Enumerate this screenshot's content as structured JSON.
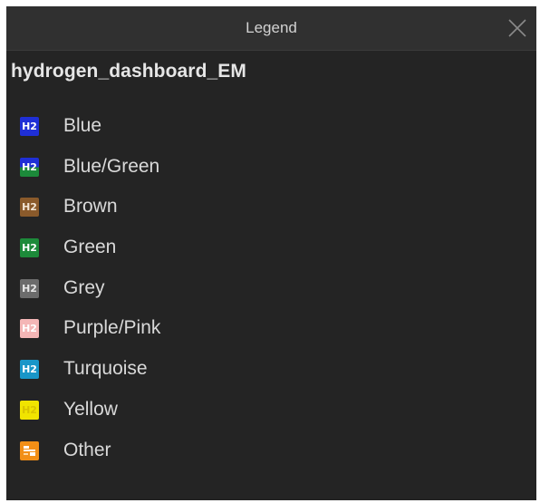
{
  "window": {
    "title": "Legend"
  },
  "layer": {
    "title": "hydrogen_dashboard_EM"
  },
  "legend": {
    "swatch_text": "H2",
    "items": [
      {
        "label": "Blue",
        "color": "#1f2fd6"
      },
      {
        "label": "Blue/Green",
        "color": "#1f2fd6/#1c8a3a"
      },
      {
        "label": "Brown",
        "color": "#8a5a2b"
      },
      {
        "label": "Green",
        "color": "#1d8a3a"
      },
      {
        "label": "Grey",
        "color": "#6c6c6c"
      },
      {
        "label": "Purple/Pink",
        "color": "#f4b6b6"
      },
      {
        "label": "Turquoise",
        "color": "#1996c8"
      },
      {
        "label": "Yellow",
        "color": "#f0e400"
      },
      {
        "label": "Other",
        "color": "#f28f16",
        "icon": "other-symbol-icon"
      }
    ]
  },
  "colors": {
    "panel_bg": "#242424",
    "titlebar_bg": "#303030",
    "text": "#d9d9d9"
  }
}
